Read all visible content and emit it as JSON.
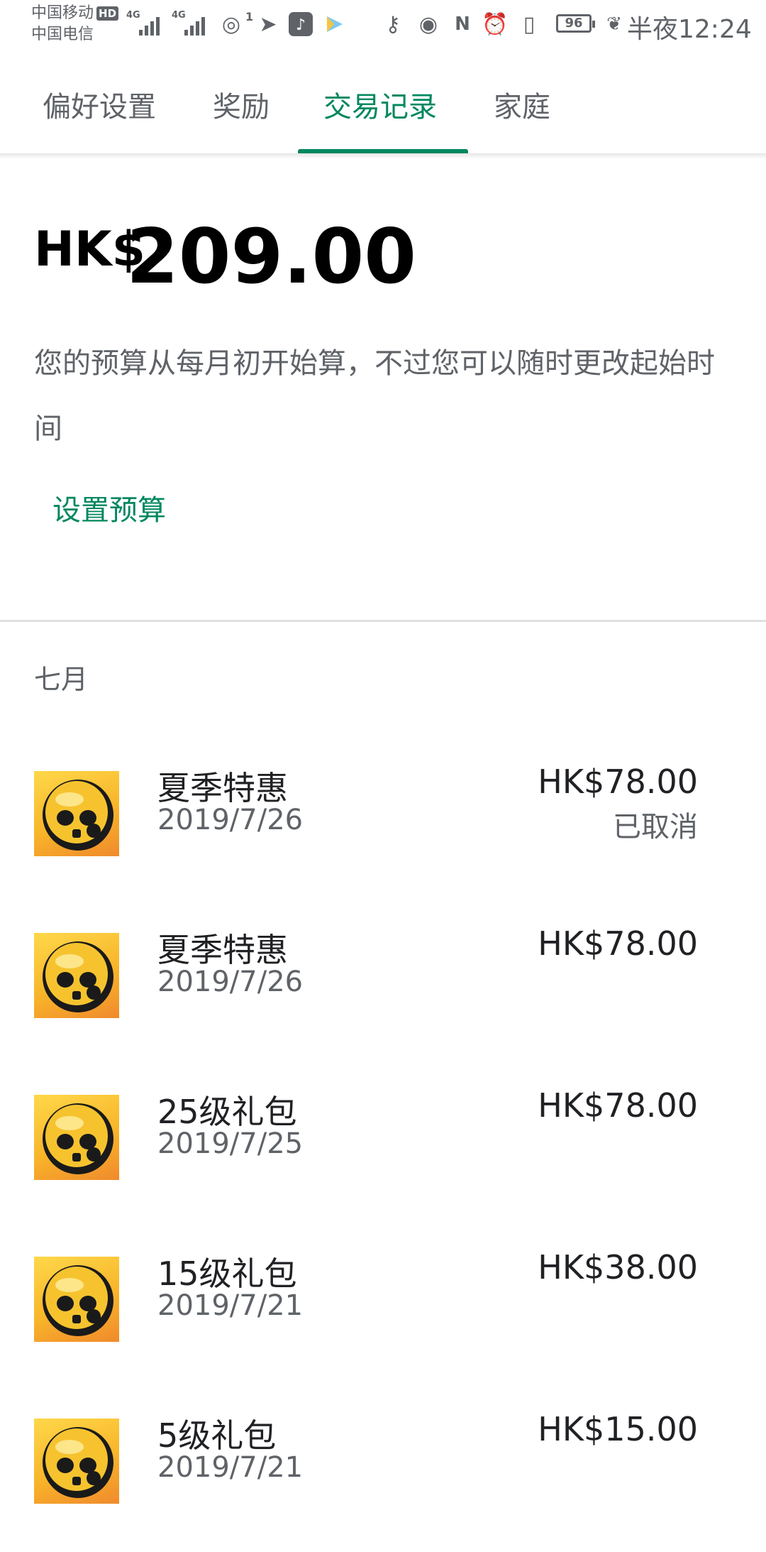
{
  "status_bar": {
    "carrier1": "中国移动",
    "hd": "HD",
    "carrier2": "中国电信",
    "net1": "4G",
    "net2": "4G",
    "hotspot_count": "1",
    "battery": "96",
    "time": "半夜12:24",
    "icons": [
      "hotspot-icon",
      "telegram-icon",
      "tiktok-icon",
      "video-play-icon",
      "key-icon",
      "eye-icon",
      "nfc-icon",
      "alarm-icon",
      "vibrate-icon",
      "leaf-icon"
    ]
  },
  "tabs": [
    {
      "label": "偏好设置"
    },
    {
      "label": "奖励"
    },
    {
      "label": "交易记录"
    },
    {
      "label": "家庭"
    }
  ],
  "active_tab": "交易记录",
  "accent_color": "#01875f",
  "budget": {
    "currency": "HK$",
    "amount": "209.00",
    "description": "您的预算从每月初开始算，不过您可以随时更改起始时间",
    "set_budget_label": "设置预算"
  },
  "transactions": {
    "month": "七月",
    "items": [
      {
        "title": "夏季特惠",
        "date": "2019/7/26",
        "price": "HK$78.00",
        "status": "已取消",
        "icon": "brawl-stars-skull-icon"
      },
      {
        "title": "夏季特惠",
        "date": "2019/7/26",
        "price": "HK$78.00",
        "status": "",
        "icon": "brawl-stars-skull-icon"
      },
      {
        "title": "25级礼包",
        "date": "2019/7/25",
        "price": "HK$78.00",
        "status": "",
        "icon": "brawl-stars-skull-icon"
      },
      {
        "title": "15级礼包",
        "date": "2019/7/21",
        "price": "HK$38.00",
        "status": "",
        "icon": "brawl-stars-skull-icon"
      },
      {
        "title": "5级礼包",
        "date": "2019/7/21",
        "price": "HK$15.00",
        "status": "",
        "icon": "brawl-stars-skull-icon"
      }
    ]
  }
}
